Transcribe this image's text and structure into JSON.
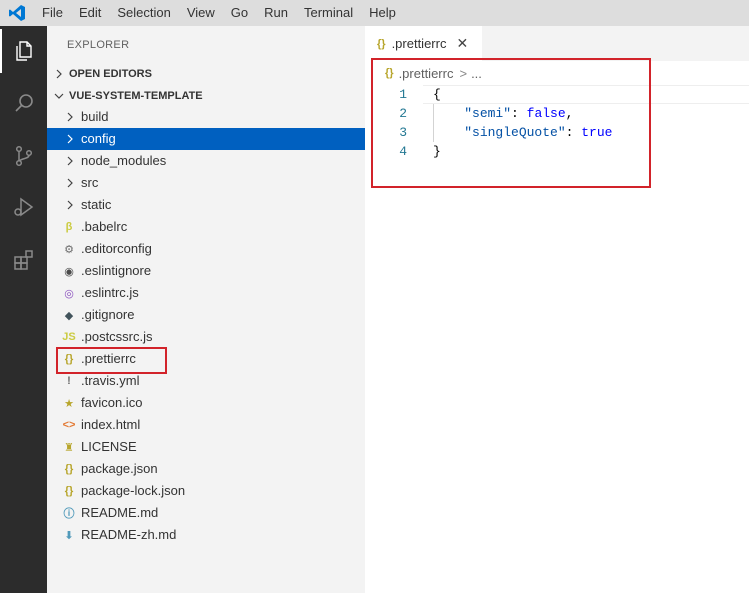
{
  "menu": [
    "File",
    "Edit",
    "Selection",
    "View",
    "Go",
    "Run",
    "Terminal",
    "Help"
  ],
  "activity": [
    {
      "name": "explorer-icon"
    },
    {
      "name": "search-icon"
    },
    {
      "name": "source-control-icon"
    },
    {
      "name": "run-debug-icon"
    },
    {
      "name": "extensions-icon"
    }
  ],
  "sidebar": {
    "title": "EXPLORER",
    "open_editors": "OPEN EDITORS",
    "project": "VUE-SYSTEM-TEMPLATE",
    "items": [
      {
        "label": "build",
        "kind": "folder"
      },
      {
        "label": "config",
        "kind": "folder",
        "selected": true
      },
      {
        "label": "node_modules",
        "kind": "folder"
      },
      {
        "label": "src",
        "kind": "folder"
      },
      {
        "label": "static",
        "kind": "folder"
      },
      {
        "label": ".babelrc",
        "kind": "file",
        "icon": "babel-icon",
        "glyph": "β",
        "color": "#cbcb41"
      },
      {
        "label": ".editorconfig",
        "kind": "file",
        "icon": "gear-icon",
        "glyph": "⚙",
        "color": "#6d6d6d"
      },
      {
        "label": ".eslintignore",
        "kind": "file",
        "icon": "eslint-ignore-icon",
        "glyph": "◉",
        "color": "#4b4b4b"
      },
      {
        "label": ".eslintrc.js",
        "kind": "file",
        "icon": "eslint-icon",
        "glyph": "◎",
        "color": "#8a4fbf"
      },
      {
        "label": ".gitignore",
        "kind": "file",
        "icon": "git-icon",
        "glyph": "◆",
        "color": "#41535b"
      },
      {
        "label": ".postcssrc.js",
        "kind": "file",
        "icon": "js-icon",
        "glyph": "JS",
        "color": "#cbcb41"
      },
      {
        "label": ".prettierrc",
        "kind": "file",
        "icon": "json-braces-icon",
        "glyph": "{}",
        "color": "#b7a52b"
      },
      {
        "label": ".travis.yml",
        "kind": "file",
        "icon": "yaml-icon",
        "glyph": "!",
        "color": "#6d6d6d"
      },
      {
        "label": "favicon.ico",
        "kind": "file",
        "icon": "star-icon",
        "glyph": "★",
        "color": "#b7a52b"
      },
      {
        "label": "index.html",
        "kind": "file",
        "icon": "html-icon",
        "glyph": "<>",
        "color": "#e37933"
      },
      {
        "label": "LICENSE",
        "kind": "file",
        "icon": "license-icon",
        "glyph": "♜",
        "color": "#b7a52b"
      },
      {
        "label": "package.json",
        "kind": "file",
        "icon": "json-braces-icon",
        "glyph": "{}",
        "color": "#b7a52b"
      },
      {
        "label": "package-lock.json",
        "kind": "file",
        "icon": "json-braces-icon",
        "glyph": "{}",
        "color": "#b7a52b"
      },
      {
        "label": "README.md",
        "kind": "file",
        "icon": "info-icon",
        "glyph": "ⓘ",
        "color": "#519aba"
      },
      {
        "label": "README-zh.md",
        "kind": "file",
        "icon": "markdown-down-icon",
        "glyph": "⬇",
        "color": "#519aba"
      }
    ]
  },
  "editor": {
    "tab_label": ".prettierrc",
    "tab_icon": "{}",
    "close_glyph": "✕",
    "breadcrumb_file": ".prettierrc",
    "breadcrumb_sep": ">",
    "breadcrumb_more": "...",
    "line_numbers": [
      "1",
      "2",
      "3",
      "4"
    ],
    "open_brace": "{",
    "close_brace": "}",
    "key1": "\"semi\"",
    "val1": "false",
    "key2": "\"singleQuote\"",
    "val2": "true"
  },
  "colors": {
    "selection": "#0060c0",
    "annotation": "#d2232a",
    "activity_bar": "#2c2c2c"
  }
}
